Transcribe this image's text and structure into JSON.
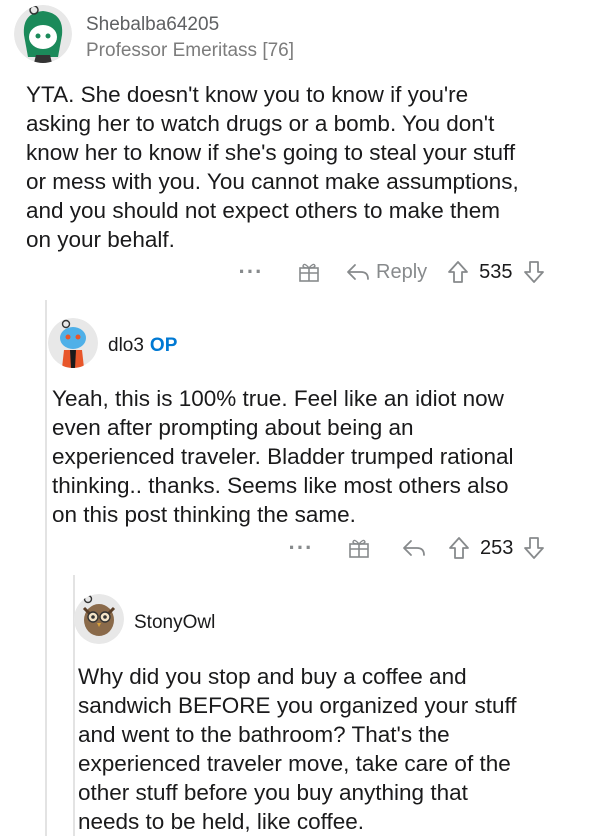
{
  "comments": [
    {
      "username": "Shebalba64205",
      "flair": "Professor Emeritass [76]",
      "lines": [
        "YTA. She doesn't know you to know if you're",
        "asking her to watch drugs or a bomb. You don't",
        "know her to know if she's going to steal your stuff",
        "or mess with you. You cannot make assumptions,",
        "and you should not expect others to make them",
        "on your behalf."
      ],
      "reply_label": "Reply",
      "votes": "535"
    },
    {
      "username": "dlo3",
      "op_tag": "OP",
      "lines": [
        "Yeah, this is 100% true. Feel like an idiot now",
        "even after prompting about being an",
        "experienced traveler. Bladder trumped rational",
        "thinking.. thanks. Seems like most others also",
        "on this post thinking the same."
      ],
      "votes": "253"
    },
    {
      "username": "StonyOwl",
      "lines": [
        "Why did you stop and buy a coffee and",
        "sandwich BEFORE you organized your stuff",
        "and went to the bathroom?  That's the",
        "experienced traveler move, take care of the",
        "other stuff before you buy anything that",
        "needs to be held, like coffee."
      ]
    }
  ],
  "icons": {
    "more": "more-options-icon",
    "award": "award-gift-icon",
    "reply": "reply-arrow-icon",
    "upvote": "upvote-arrow-icon",
    "downvote": "downvote-arrow-icon"
  },
  "colors": {
    "op_tag": "#0079d3",
    "meta_text": "#878a8c",
    "thread_line": "#e3e3e3"
  }
}
